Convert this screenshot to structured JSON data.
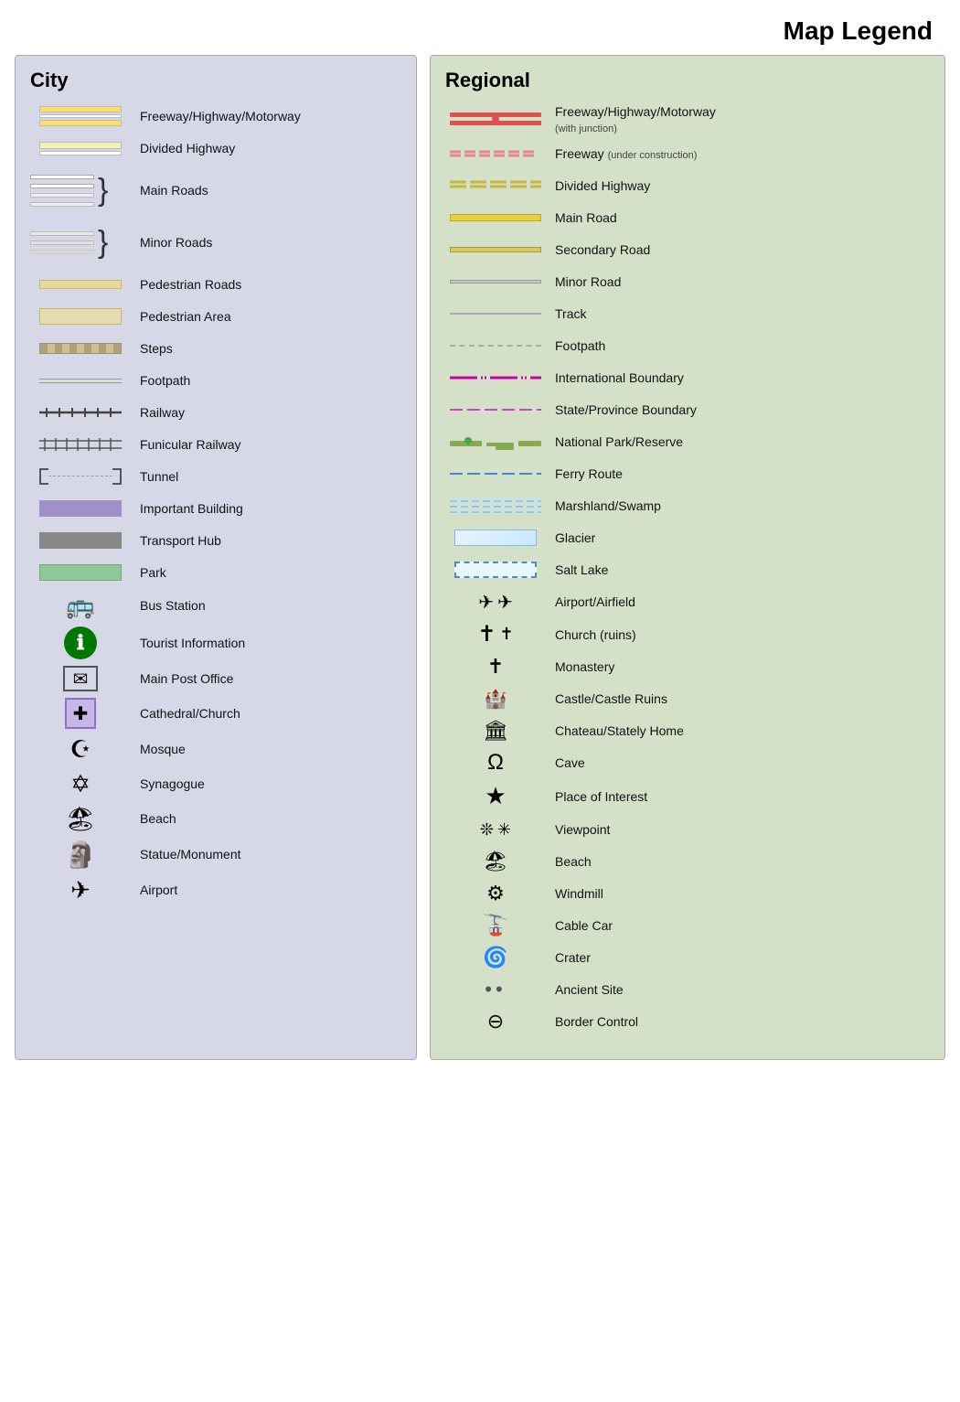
{
  "title": "Map Legend",
  "city": {
    "heading": "City",
    "items": [
      {
        "id": "freeway",
        "label": "Freeway/Highway/Motorway"
      },
      {
        "id": "divided-highway",
        "label": "Divided Highway"
      },
      {
        "id": "main-roads",
        "label": "Main Roads"
      },
      {
        "id": "minor-roads",
        "label": "Minor Roads"
      },
      {
        "id": "pedestrian-roads",
        "label": "Pedestrian Roads"
      },
      {
        "id": "pedestrian-area",
        "label": "Pedestrian Area"
      },
      {
        "id": "steps",
        "label": "Steps"
      },
      {
        "id": "footpath",
        "label": "Footpath"
      },
      {
        "id": "railway",
        "label": "Railway"
      },
      {
        "id": "funicular",
        "label": "Funicular Railway"
      },
      {
        "id": "tunnel",
        "label": "Tunnel"
      },
      {
        "id": "important-building",
        "label": "Important Building"
      },
      {
        "id": "transport-hub",
        "label": "Transport Hub"
      },
      {
        "id": "park",
        "label": "Park"
      },
      {
        "id": "bus-station",
        "label": "Bus Station"
      },
      {
        "id": "tourist-info",
        "label": "Tourist Information"
      },
      {
        "id": "post-office",
        "label": "Main Post Office"
      },
      {
        "id": "cathedral",
        "label": "Cathedral/Church"
      },
      {
        "id": "mosque",
        "label": "Mosque"
      },
      {
        "id": "synagogue",
        "label": "Synagogue"
      },
      {
        "id": "beach-city",
        "label": "Beach"
      },
      {
        "id": "statue",
        "label": "Statue/Monument"
      },
      {
        "id": "airport-city",
        "label": "Airport"
      }
    ]
  },
  "regional": {
    "heading": "Regional",
    "items": [
      {
        "id": "reg-freeway",
        "label": "Freeway/Highway/Motorway",
        "sublabel": "(with junction)"
      },
      {
        "id": "reg-freeway-construction",
        "label": "Freeway",
        "sublabel": "(under construction)"
      },
      {
        "id": "reg-divided",
        "label": "Divided Highway"
      },
      {
        "id": "reg-main",
        "label": "Main Road"
      },
      {
        "id": "reg-secondary",
        "label": "Secondary Road"
      },
      {
        "id": "reg-minor",
        "label": "Minor Road"
      },
      {
        "id": "reg-track",
        "label": "Track"
      },
      {
        "id": "reg-footpath",
        "label": "Footpath"
      },
      {
        "id": "reg-intl-boundary",
        "label": "International Boundary"
      },
      {
        "id": "reg-state-boundary",
        "label": "State/Province Boundary"
      },
      {
        "id": "reg-national-park",
        "label": "National Park/Reserve"
      },
      {
        "id": "reg-ferry-route",
        "label": "Ferry Route"
      },
      {
        "id": "reg-marsh",
        "label": "Marshland/Swamp"
      },
      {
        "id": "reg-glacier",
        "label": "Glacier"
      },
      {
        "id": "reg-salt-lake",
        "label": "Salt Lake"
      },
      {
        "id": "reg-airport",
        "label": "Airport/Airfield"
      },
      {
        "id": "reg-church",
        "label": "Church (ruins)"
      },
      {
        "id": "reg-monastery",
        "label": "Monastery"
      },
      {
        "id": "reg-castle",
        "label": "Castle/Castle Ruins"
      },
      {
        "id": "reg-chateau",
        "label": "Chateau/Stately Home"
      },
      {
        "id": "reg-cave",
        "label": "Cave"
      },
      {
        "id": "reg-poi",
        "label": "Place of Interest"
      },
      {
        "id": "reg-viewpoint",
        "label": "Viewpoint"
      },
      {
        "id": "reg-beach",
        "label": "Beach"
      },
      {
        "id": "reg-windmill",
        "label": "Windmill"
      },
      {
        "id": "reg-cable-car",
        "label": "Cable Car"
      },
      {
        "id": "reg-crater",
        "label": "Crater"
      },
      {
        "id": "reg-ancient",
        "label": "Ancient Site"
      },
      {
        "id": "reg-border",
        "label": "Border Control"
      }
    ]
  }
}
